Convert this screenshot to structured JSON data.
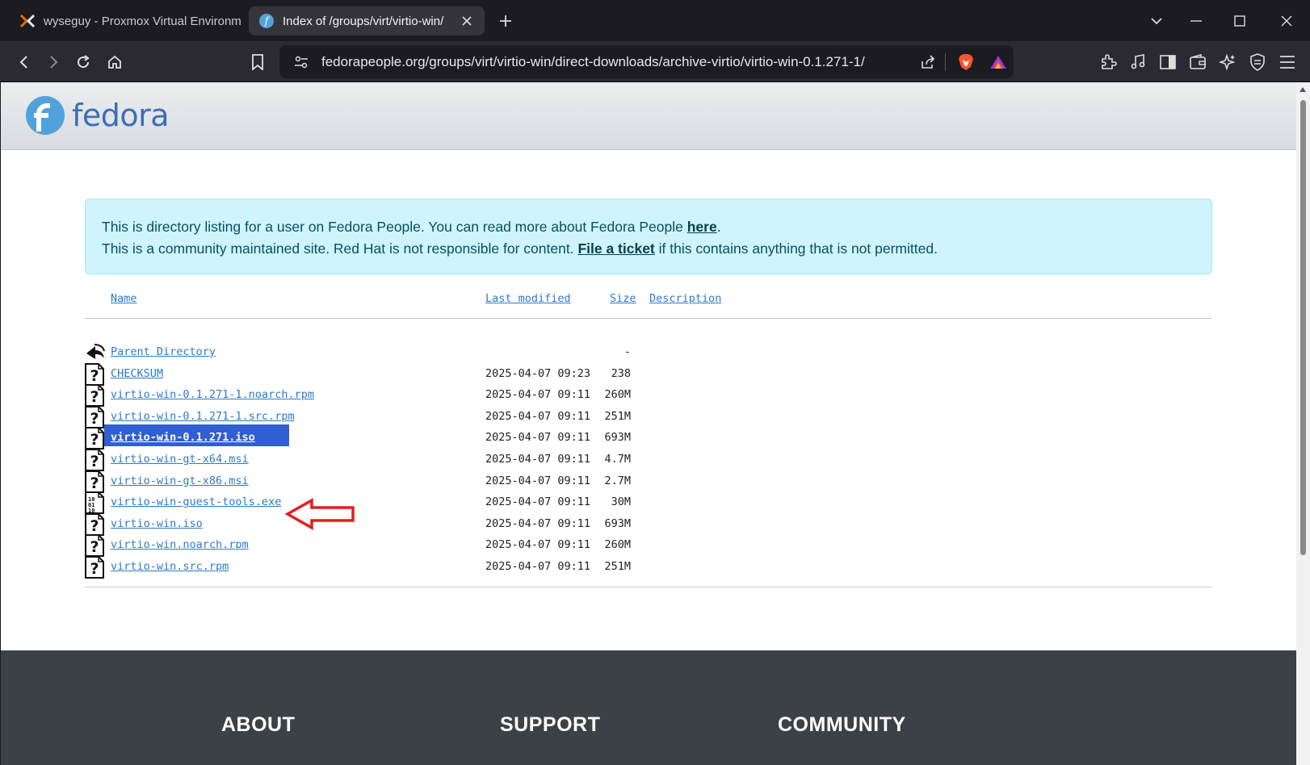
{
  "browser": {
    "tabs": [
      {
        "label": "wyseguy - Proxmox Virtual Environm",
        "active": false
      },
      {
        "label": "Index of /groups/virt/virtio-win/",
        "active": true
      }
    ],
    "url": "fedorapeople.org/groups/virt/virtio-win/direct-downloads/archive-virtio/virtio-win-0.1.271-1/",
    "accent": "#fb542b"
  },
  "header": {
    "logo_text": "fedora",
    "brand_color": "#3c6eb4"
  },
  "notice": {
    "line1_prefix": "This is directory listing for a user on Fedora People. You can read more about Fedora People ",
    "line1_link": "here",
    "line1_suffix": ".",
    "line2_prefix": "This is a community maintained site. Red Hat is not responsible for content. ",
    "line2_link": "File a ticket",
    "line2_suffix": " if this contains anything that is not permitted."
  },
  "listing": {
    "columns": {
      "name": "Name",
      "modified": "Last modified",
      "size": "Size",
      "description": "Description"
    },
    "rows": [
      {
        "name": "Parent Directory",
        "date": "",
        "size": "-",
        "icon": "back-icon"
      },
      {
        "name": "CHECKSUM",
        "date": "2025-04-07 09:23",
        "size": "238",
        "icon": "unknown-file-icon"
      },
      {
        "name": "virtio-win-0.1.271-1.noarch.rpm",
        "date": "2025-04-07 09:11",
        "size": "260M",
        "icon": "unknown-file-icon"
      },
      {
        "name": "virtio-win-0.1.271-1.src.rpm",
        "date": "2025-04-07 09:11",
        "size": "251M",
        "icon": "unknown-file-icon"
      },
      {
        "name": "virtio-win-0.1.271.iso",
        "date": "2025-04-07 09:11",
        "size": "693M",
        "icon": "unknown-file-icon",
        "selected": true
      },
      {
        "name": "virtio-win-gt-x64.msi",
        "date": "2025-04-07 09:11",
        "size": "4.7M",
        "icon": "unknown-file-icon"
      },
      {
        "name": "virtio-win-gt-x86.msi",
        "date": "2025-04-07 09:11",
        "size": "2.7M",
        "icon": "unknown-file-icon"
      },
      {
        "name": "virtio-win-guest-tools.exe",
        "date": "2025-04-07 09:11",
        "size": "30M",
        "icon": "binary-file-icon"
      },
      {
        "name": "virtio-win.iso",
        "date": "2025-04-07 09:11",
        "size": "693M",
        "icon": "unknown-file-icon"
      },
      {
        "name": "virtio-win.noarch.rpm",
        "date": "2025-04-07 09:11",
        "size": "260M",
        "icon": "unknown-file-icon"
      },
      {
        "name": "virtio-win.src.rpm",
        "date": "2025-04-07 09:11",
        "size": "251M",
        "icon": "unknown-file-icon"
      }
    ]
  },
  "footer": {
    "headings": [
      "ABOUT",
      "SUPPORT",
      "COMMUNITY"
    ]
  }
}
